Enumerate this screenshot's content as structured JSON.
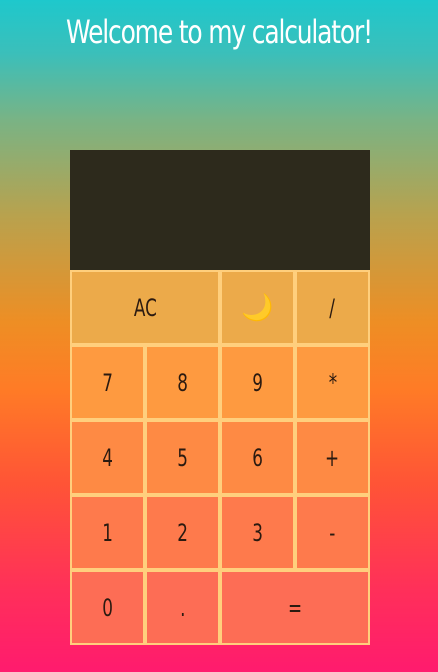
{
  "title": "Welcome to my calculator!",
  "display": {
    "value": ""
  },
  "keys": {
    "clear": "AC",
    "theme_toggle": "🌙",
    "divide": "/",
    "seven": "7",
    "eight": "8",
    "nine": "9",
    "multiply": "*",
    "four": "4",
    "five": "5",
    "six": "6",
    "add": "+",
    "one": "1",
    "two": "2",
    "three": "3",
    "subtract": "-",
    "zero": "0",
    "decimal": ".",
    "equals": "="
  },
  "colors": {
    "display_background": "#2d2a1c",
    "key_border": "#ffcf7d",
    "key_text": "#2b1a10",
    "title_text": "#ffffff"
  }
}
